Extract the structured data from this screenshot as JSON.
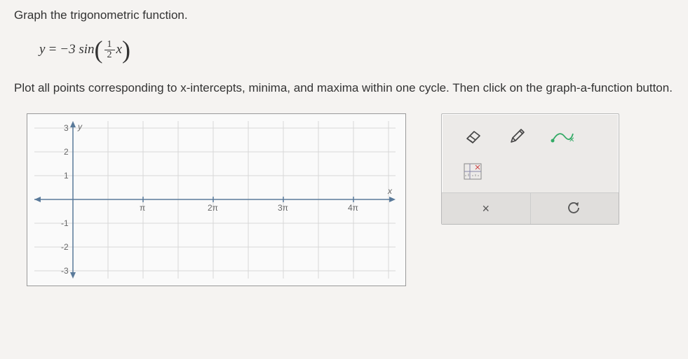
{
  "question": {
    "title": "Graph the trigonometric function.",
    "formula": {
      "lhs": "y",
      "eq": "=",
      "coef": "−3 sin",
      "num": "1",
      "den": "2",
      "var": "x"
    },
    "instruction": "Plot all points corresponding to x-intercepts, minima, and maxima within one cycle. Then click on the graph-a-function button."
  },
  "graph": {
    "y_ticks": [
      "3",
      "2",
      "1",
      "-1",
      "-2",
      "-3"
    ],
    "x_ticks": [
      "π",
      "2π",
      "3π",
      "4π"
    ],
    "x_axis_label": "x",
    "y_axis_label": "y"
  },
  "tools": {
    "eraser": "eraser-icon",
    "pencil": "pencil-icon",
    "curve": "curve-icon",
    "graph_fn": "graph-a-function-icon",
    "clear": "×",
    "reset": "↺"
  },
  "chart_data": {
    "type": "line",
    "title": "",
    "xlabel": "x",
    "ylabel": "y",
    "xlim_labels": [
      "0",
      "4π"
    ],
    "ylim": [
      -3,
      3
    ],
    "x_ticks": [
      "π",
      "2π",
      "3π",
      "4π"
    ],
    "y_ticks": [
      -3,
      -2,
      -1,
      1,
      2,
      3
    ],
    "series": [
      {
        "name": "y = -3 sin( (1/2) x )",
        "values": []
      }
    ],
    "note": "empty grid awaiting user-plotted points"
  }
}
